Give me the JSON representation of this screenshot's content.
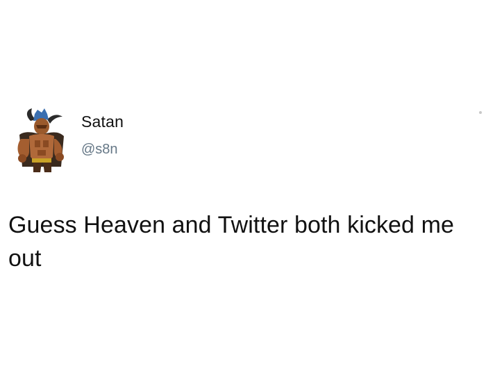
{
  "tweet": {
    "author": {
      "display_name": "Satan",
      "handle": "@s8n",
      "avatar_icon": "horned-demon-avatar-icon"
    },
    "text": "Guess Heaven and Twitter both kicked me out"
  },
  "colors": {
    "background": "#ffffff",
    "text": "#111111",
    "handle": "#657786"
  }
}
